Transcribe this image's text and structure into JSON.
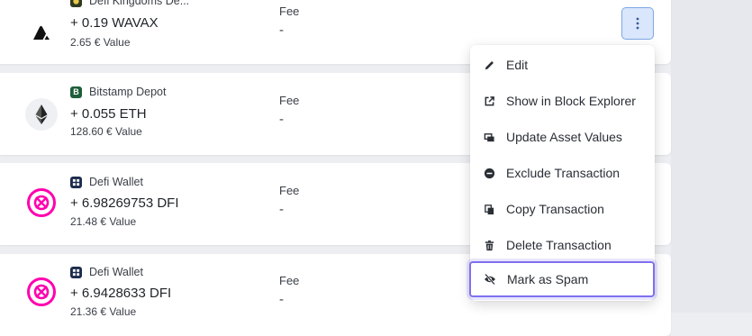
{
  "transactions": [
    {
      "wallet": "Defi Kingdoms De...",
      "amount": "+ 0.19 WAVAX",
      "value": "2.65 € Value",
      "fee_label": "Fee",
      "fee_value": "-"
    },
    {
      "wallet": "Bitstamp Depot",
      "amount": "+ 0.055 ETH",
      "value": "128.60 € Value",
      "fee_label": "Fee",
      "fee_value": "-"
    },
    {
      "wallet": "Defi Wallet",
      "amount": "+ 6.98269753 DFI",
      "value": "21.48 € Value",
      "fee_label": "Fee",
      "fee_value": "-"
    },
    {
      "wallet": "Defi Wallet",
      "amount": "+ 6.9428633 DFI",
      "value": "21.36 € Value",
      "fee_label": "Fee",
      "fee_value": "-"
    }
  ],
  "menu": {
    "items": [
      {
        "label": "Edit",
        "icon": "pencil-icon"
      },
      {
        "label": "Show in Block Explorer",
        "icon": "external-link-icon"
      },
      {
        "label": "Update Asset Values",
        "icon": "update-values-icon"
      },
      {
        "label": "Exclude Transaction",
        "icon": "minus-circle-icon"
      },
      {
        "label": "Copy Transaction",
        "icon": "copy-icon"
      },
      {
        "label": "Delete Transaction",
        "icon": "trash-icon"
      },
      {
        "label": "Mark as Spam",
        "icon": "eye-off-icon"
      }
    ]
  },
  "colors": {
    "accent_focus": "#7e70f0",
    "kebab_bg": "#d9e6fb",
    "defi_pink": "#ff00af",
    "bitstamp_green": "#1e5e3a"
  }
}
